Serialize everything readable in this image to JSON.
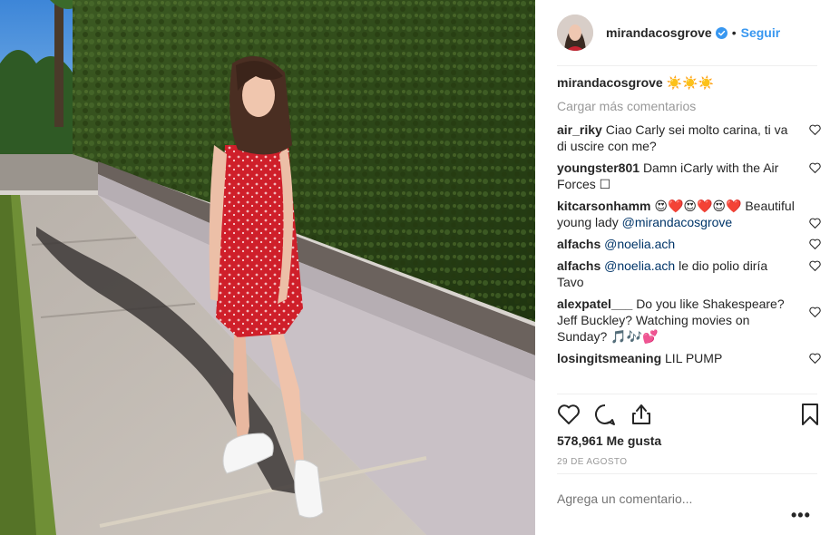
{
  "post": {
    "username": "mirandacosgrove",
    "follow_label": "Seguir",
    "separator": "•",
    "caption_user": "mirandacosgrove",
    "caption_emoji": "☀️☀️☀️",
    "load_more": "Cargar más comentarios",
    "comments": [
      {
        "user": "air_riky",
        "text": "Ciao Carly sei molto carina, ti va di uscire con me?"
      },
      {
        "user": "youngster801",
        "text": "Damn iCarly with the Air Forces ☐"
      },
      {
        "user": "kitcarsonhamm",
        "text": "😍❤️😍❤️😍❤️ Beautiful young lady",
        "mention": "@mirandacosgrove"
      },
      {
        "user": "alfachs",
        "mention": "@noelia.ach",
        "text": ""
      },
      {
        "user": "alfachs",
        "mention": "@noelia.ach",
        "text": "le dio polio diría Tavo"
      },
      {
        "user": "alexpatel___",
        "text": "Do you like Shakespeare? Jeff Buckley? Watching movies on Sunday? 🎵🎶💕"
      },
      {
        "user": "losingitsmeaning",
        "text": "LIL PUMP"
      }
    ],
    "likes": "578,961 Me gusta",
    "date": "29 DE AGOSTO",
    "add_comment_placeholder": "Agrega un comentario...",
    "more_options": "•••"
  },
  "icons": {
    "verified": "verified-badge-icon",
    "heart": "heart-icon",
    "comment": "comment-icon",
    "share": "share-icon",
    "save": "bookmark-icon"
  },
  "colors": {
    "link_blue": "#3897f0",
    "mention": "#003569",
    "muted": "#999999",
    "text": "#262626"
  }
}
